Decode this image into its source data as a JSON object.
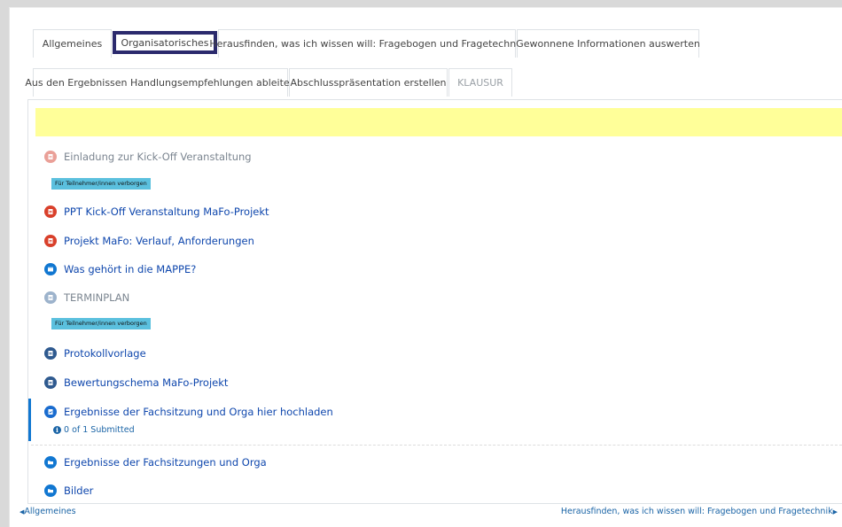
{
  "tabs": {
    "row1": [
      {
        "label": "Allgemeines",
        "state": "normal"
      },
      {
        "label": "Organisatorisches",
        "state": "active"
      },
      {
        "label": "Herausfinden, was ich wissen will: Fragebogen und Fragetechnik",
        "state": "normal"
      },
      {
        "label": "Gewonnene Informationen auswerten",
        "state": "normal"
      }
    ],
    "row2": [
      {
        "label": "Aus den Ergebnissen Handlungsempfehlungen ableiten",
        "state": "normal"
      },
      {
        "label": "Abschlusspräsentation erstellen",
        "state": "normal"
      },
      {
        "label": "KLAUSUR",
        "state": "disabled"
      }
    ]
  },
  "activities": [
    {
      "label": "Einladung zur Kick-Off Veranstaltung",
      "icon": "pdf-icon",
      "hidden": true
    },
    {
      "label": "PPT Kick-Off Veranstaltung MaFo-Projekt",
      "icon": "pdf-icon",
      "hidden": false
    },
    {
      "label": "Projekt MaFo: Verlauf, Anforderungen",
      "icon": "pdf-icon",
      "hidden": false
    },
    {
      "label": "Was gehört in die MAPPE?",
      "icon": "page-icon",
      "hidden": false
    },
    {
      "label": "TERMINPLAN",
      "icon": "page-icon",
      "hidden": true
    },
    {
      "label": "Protokollvorlage",
      "icon": "resource-icon",
      "hidden": false
    },
    {
      "label": "Bewertungschema MaFo-Projekt",
      "icon": "resource-icon",
      "hidden": false
    },
    {
      "label": "Ergebnisse der Fachsitzung und Orga hier hochladen",
      "icon": "assignment-icon",
      "hidden": false
    },
    {
      "label": "Ergebnisse der Fachsitzungen und Orga",
      "icon": "folder-icon",
      "hidden": false
    },
    {
      "label": "Bilder",
      "icon": "folder-icon",
      "hidden": false
    }
  ],
  "hidden_badge": "Für Teilnehmer/innen verborgen",
  "assignment_status": "0 of 1 Submitted",
  "nav": {
    "prev": "Allgemeines",
    "next": "Herausfinden, was ich wissen will: Fragebogen und Fragetechnik"
  },
  "colors": {
    "active_tab_border": "#2b2a6d",
    "highlight_banner": "#ffff99",
    "badge_bg": "#5bc0de",
    "link": "#0f47ad",
    "pdf_icon": "#d9402b"
  }
}
